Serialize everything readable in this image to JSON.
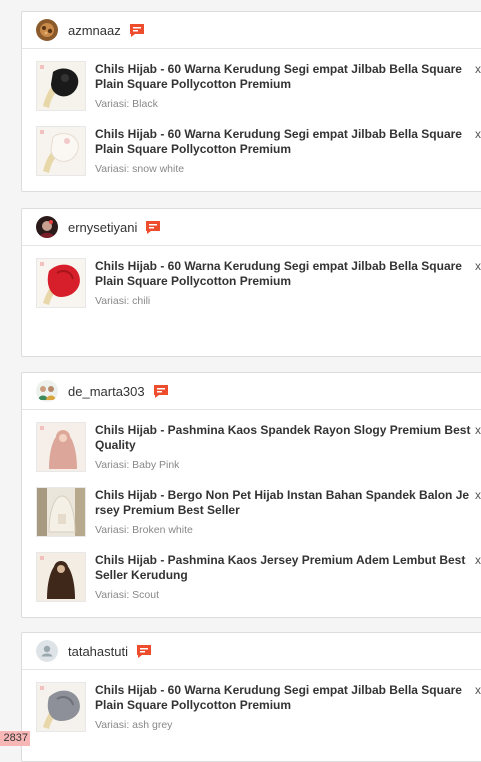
{
  "orders": [
    {
      "username": "azmnaaz",
      "avatar": "avatar-photo",
      "items": [
        {
          "title": "Chils Hijab - 60 Warna Kerudung Segi empat Jilbab Bella Square Plain Square Pollycotton Premium",
          "variant": "Variasi: Black",
          "remove": "x",
          "image": "black-hijab"
        },
        {
          "title": "Chils Hijab - 60 Warna Kerudung Segi empat Jilbab Bella Square Plain Square Pollycotton Premium",
          "variant": "Variasi: snow white",
          "remove": "x",
          "image": "white-hijab"
        }
      ]
    },
    {
      "username": "ernysetiyani",
      "avatar": "avatar-photo",
      "items": [
        {
          "title": "Chils Hijab - 60 Warna Kerudung Segi empat Jilbab Bella Square Plain Square Pollycotton Premium",
          "variant": "Variasi: chili",
          "remove": "x",
          "image": "red-hijab"
        }
      ]
    },
    {
      "username": "de_marta303",
      "avatar": "avatar-photo",
      "items": [
        {
          "title": "Chils Hijab - Pashmina Kaos Spandek Rayon Slogy Premium Best Quality",
          "variant": "Variasi: Baby Pink",
          "remove": "x",
          "image": "pink-pashmina"
        },
        {
          "title": "Chils Hijab - Bergo Non Pet Hijab Instan Bahan Spandek Balon Jersey Premium Best Seller",
          "variant": "Variasi: Broken white",
          "remove": "x",
          "image": "white-bergo"
        },
        {
          "title": "Chils Hijab - Pashmina Kaos Jersey Premium Adem Lembut Best Seller Kerudung",
          "variant": "Variasi: Scout",
          "remove": "x",
          "image": "brown-pashmina"
        }
      ]
    },
    {
      "username": "tatahastuti",
      "avatar": "avatar-default-icon",
      "items": [
        {
          "title": "Chils Hijab - 60 Warna Kerudung Segi empat Jilbab Bella Square Plain Square Pollycotton Premium",
          "variant": "Variasi: ash grey",
          "remove": "x",
          "image": "grey-hijab"
        }
      ]
    }
  ],
  "page_badge": "2837",
  "colors": {
    "chat_icon": "#ee4d2d",
    "title_text": "#333333",
    "variant_text": "#888888",
    "badge_bg": "#f8b7b7"
  }
}
